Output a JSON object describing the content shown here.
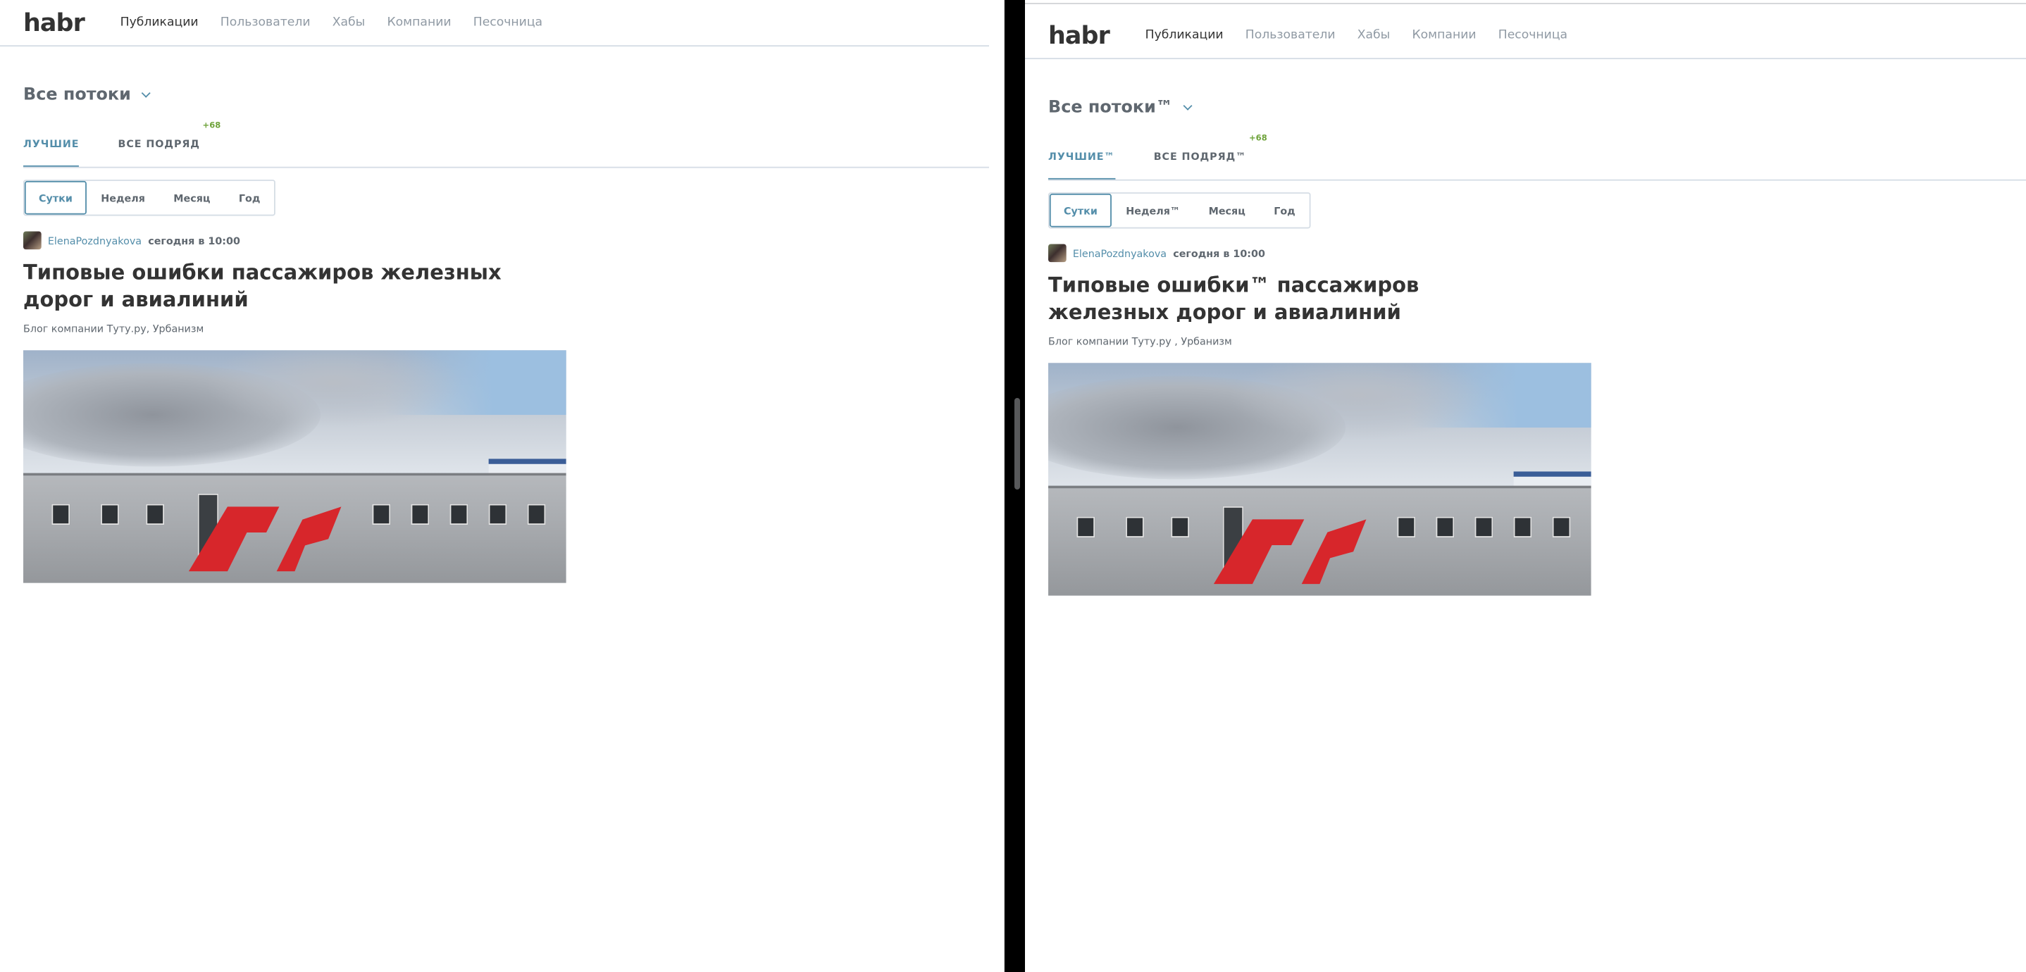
{
  "panes": [
    {
      "id": "left",
      "header": {
        "logo": "habr",
        "nav": [
          {
            "label": "Публикации",
            "active": true
          },
          {
            "label": "Пользователи",
            "active": false
          },
          {
            "label": "Хабы",
            "active": false
          },
          {
            "label": "Компании",
            "active": false
          },
          {
            "label": "Песочница",
            "active": false
          }
        ]
      },
      "flows_label": "Все потоки",
      "tabs": [
        {
          "label": "ЛУЧШИЕ",
          "active": true,
          "count": ""
        },
        {
          "label": "ВСЕ ПОДРЯД",
          "active": false,
          "count": "+68"
        }
      ],
      "periods": [
        {
          "label": "Сутки",
          "active": true
        },
        {
          "label": "Неделя",
          "active": false
        },
        {
          "label": "Месяц",
          "active": false
        },
        {
          "label": "Год",
          "active": false
        }
      ],
      "post": {
        "author": "ElenaPozdnyakova",
        "time": "сегодня в 10:00",
        "title": "Типовые ошибки пассажиров железных дорог и авиалиний",
        "hubs": "Блог компании Туту.ру,  Урбанизм"
      }
    },
    {
      "id": "right",
      "header": {
        "logo": "habr",
        "nav": [
          {
            "label": "Публикации",
            "active": true
          },
          {
            "label": "Пользователи",
            "active": false
          },
          {
            "label": "Хабы",
            "active": false
          },
          {
            "label": "Компании",
            "active": false
          },
          {
            "label": "Песочница",
            "active": false
          }
        ]
      },
      "flows_label": "Все потоки™",
      "tabs": [
        {
          "label": "ЛУЧШИЕ™",
          "active": true,
          "count": ""
        },
        {
          "label": "ВСЕ ПОДРЯД™",
          "active": false,
          "count": "+68"
        }
      ],
      "periods": [
        {
          "label": "Сутки",
          "active": true
        },
        {
          "label": "Неделя™",
          "active": false
        },
        {
          "label": "Месяц",
          "active": false
        },
        {
          "label": "Год",
          "active": false
        }
      ],
      "post": {
        "author": "ElenaPozdnyakova",
        "time": "сегодня в 10:00",
        "title": "Типовые ошибки™ пассажиров железных дорог и авиалиний",
        "hubs": "Блог компании Туту.ру ,  Урбанизм"
      }
    }
  ],
  "colors": {
    "accent": "#548eaa",
    "text": "#333333",
    "muted": "#5f676f",
    "nav_muted": "#909aa4",
    "count_green": "#6fa33b",
    "border": "#d5dde5"
  }
}
